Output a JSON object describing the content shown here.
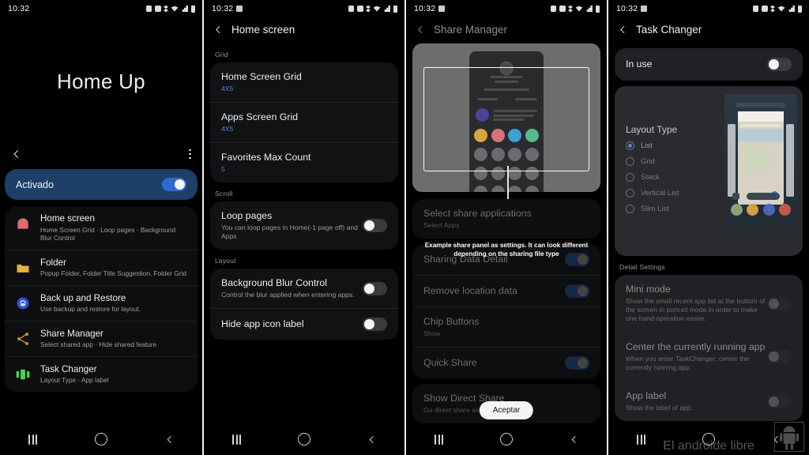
{
  "statusbar": {
    "time": "10:32",
    "icons": [
      "image-icon",
      "alarm-icon",
      "alarm2-icon",
      "bluetooth-icon",
      "wifi-icon",
      "signal-icon",
      "battery-icon"
    ]
  },
  "navbar": {
    "recents": "recents-icon",
    "home": "home-icon",
    "back": "back-icon"
  },
  "panel1": {
    "hero_title": "Home Up",
    "back_icon": "back-chevron-icon",
    "overflow_icon": "more-options-icon",
    "master_switch": {
      "label": "Activado",
      "state": "on"
    },
    "items": [
      {
        "title": "Home screen",
        "desc": "Home Screen Grid · Loop pages · Background Blur Control",
        "icon": "home-icon",
        "color": "#e06b73"
      },
      {
        "title": "Folder",
        "desc": "Popup Folder, Folder Title Suggestion, Folder Grid",
        "icon": "folder-icon",
        "color": "#e8ae3c"
      },
      {
        "title": "Back up and Restore",
        "desc": "Use backup and restore for layout.",
        "icon": "backup-icon",
        "color": "#2b4fd1"
      },
      {
        "title": "Share Manager",
        "desc": "Select shared app · Hide shared feature",
        "icon": "share-icon",
        "color": "#c98a3a"
      },
      {
        "title": "Task Changer",
        "desc": "Layout Type · App label",
        "icon": "task-changer-icon",
        "color": "#4fd14f"
      }
    ]
  },
  "panel2": {
    "title": "Home screen",
    "back_icon": "back-chevron-icon",
    "sections": [
      {
        "label": "Grid",
        "rows": [
          {
            "title": "Home Screen Grid",
            "value": "4X5",
            "control": "none"
          },
          {
            "title": "Apps Screen Grid",
            "value": "4X5",
            "control": "none"
          },
          {
            "title": "Favorites Max Count",
            "value": "5",
            "control": "none"
          }
        ]
      },
      {
        "label": "Scroll",
        "rows": [
          {
            "title": "Loop pages",
            "desc": "You can loop pages in Home(-1 page off) and Apps",
            "control": "toggle",
            "state": "off"
          }
        ]
      },
      {
        "label": "Layout",
        "rows": [
          {
            "title": "Background Blur Control",
            "desc": "Control the blur applied when entering apps.",
            "control": "toggle",
            "state": "off"
          },
          {
            "title": "Hide app icon label",
            "desc": "",
            "control": "toggle",
            "state": "off"
          }
        ]
      }
    ]
  },
  "panel3": {
    "title": "Share Manager",
    "back_icon": "back-chevron-icon",
    "preview_name": "share-panel-preview",
    "tooltip": "Example share panel as settings. It can look different depending on the sharing file type",
    "accept_button": "Aceptar",
    "rows": [
      {
        "title": "Select share applications",
        "desc": "Select Apps",
        "control": "none"
      },
      {
        "title": "Sharing Data Detail",
        "desc": "",
        "control": "toggle",
        "state": "on"
      },
      {
        "title": "Remove location data",
        "desc": "",
        "control": "toggle",
        "state": "on"
      },
      {
        "title": "Chip Buttons",
        "desc": "Show",
        "control": "none"
      },
      {
        "title": "Quick Share",
        "desc": "",
        "control": "toggle",
        "state": "on"
      },
      {
        "title": "Show Direct Share",
        "desc": "Go direct share settings page",
        "control": "none"
      }
    ]
  },
  "panel4": {
    "title": "Task Changer",
    "back_icon": "back-chevron-icon",
    "in_use": {
      "label": "In use",
      "state": "off"
    },
    "layout_type_title": "Layout Type",
    "layout_options": [
      {
        "label": "List",
        "selected": true
      },
      {
        "label": "Grid",
        "selected": false
      },
      {
        "label": "Stack",
        "selected": false
      },
      {
        "label": "Vertical List",
        "selected": false
      },
      {
        "label": "Slim List",
        "selected": false
      }
    ],
    "detail_label": "Detail Settings",
    "detail_rows": [
      {
        "title": "Mini mode",
        "desc": "Show the small recent app list at the bottom of the screen in portrait mode in order to make one hand operation easier.",
        "state": "off"
      },
      {
        "title": "Center the currently running app",
        "desc": "When you enter TaskChanger, center the currently running app.",
        "state": "off"
      },
      {
        "title": "App label",
        "desc": "Show the label of app.",
        "state": "off"
      }
    ],
    "watermark": "El androide libre"
  }
}
